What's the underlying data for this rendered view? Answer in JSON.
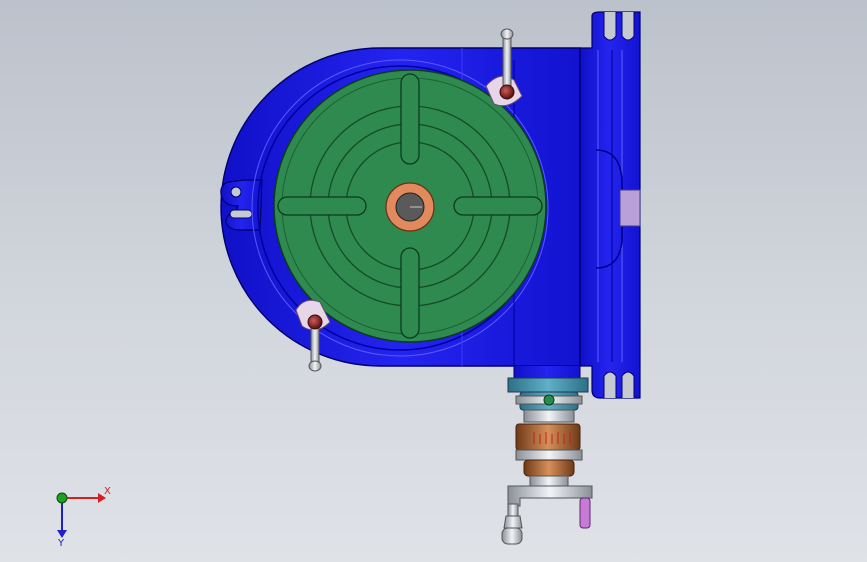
{
  "viewport": {
    "background_top": "#bcc2cb",
    "background_bottom": "#dfe2e7"
  },
  "model": {
    "body_color": "#1a1ae6",
    "table_color": "#2f8a4f",
    "hub_color": "#e08a5e",
    "handle_color": "#c87bd6"
  },
  "triad": {
    "x_label": "X",
    "y_label": "Y",
    "x_color": "#d42020",
    "y_color": "#2020c8",
    "origin_color": "#20a020"
  }
}
